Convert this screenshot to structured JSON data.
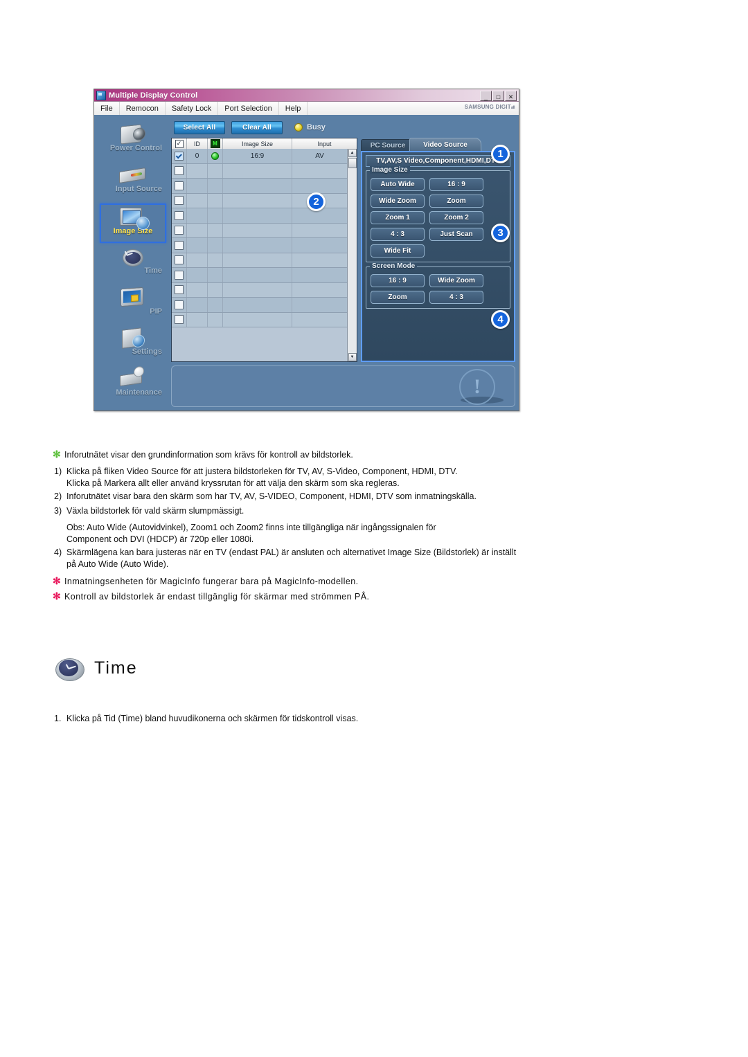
{
  "app": {
    "title": "Multiple Display Control",
    "window_buttons": [
      "_",
      "□",
      "✕"
    ],
    "menu": [
      "File",
      "Remocon",
      "Safety Lock",
      "Port Selection",
      "Help"
    ],
    "brand": "SAMSUNG DIGIT",
    "brand_tail": "all",
    "sidebar": [
      {
        "label": "Power Control",
        "icon": "camera-icon",
        "selected": false
      },
      {
        "label": "Input Source",
        "icon": "input-device-icon",
        "selected": false
      },
      {
        "label": "Image Size",
        "icon": "monitor-image-size-icon",
        "selected": true
      },
      {
        "label": "Time",
        "icon": "clock-icon",
        "selected": false
      },
      {
        "label": "PIP",
        "icon": "pip-monitor-icon",
        "selected": false
      },
      {
        "label": "Settings",
        "icon": "settings-cube-icon",
        "selected": false
      },
      {
        "label": "Maintenance",
        "icon": "maintenance-tool-icon",
        "selected": false
      }
    ],
    "toolbar": {
      "select_all": "Select All",
      "clear_all": "Clear All",
      "status_label": "Busy",
      "status_color": "#e8d52e"
    },
    "table": {
      "columns": [
        "",
        "ID",
        "M",
        "Image Size",
        "Input"
      ],
      "header_check": "✓",
      "rows": [
        {
          "checked": true,
          "id": "0",
          "power": true,
          "image_size": "16:9",
          "input": "AV"
        },
        {
          "checked": false,
          "id": "",
          "power": false,
          "image_size": "",
          "input": ""
        },
        {
          "checked": false,
          "id": "",
          "power": false,
          "image_size": "",
          "input": ""
        },
        {
          "checked": false,
          "id": "",
          "power": false,
          "image_size": "",
          "input": ""
        },
        {
          "checked": false,
          "id": "",
          "power": false,
          "image_size": "",
          "input": ""
        },
        {
          "checked": false,
          "id": "",
          "power": false,
          "image_size": "",
          "input": ""
        },
        {
          "checked": false,
          "id": "",
          "power": false,
          "image_size": "",
          "input": ""
        },
        {
          "checked": false,
          "id": "",
          "power": false,
          "image_size": "",
          "input": ""
        },
        {
          "checked": false,
          "id": "",
          "power": false,
          "image_size": "",
          "input": ""
        },
        {
          "checked": false,
          "id": "",
          "power": false,
          "image_size": "",
          "input": ""
        },
        {
          "checked": false,
          "id": "",
          "power": false,
          "image_size": "",
          "input": ""
        },
        {
          "checked": false,
          "id": "",
          "power": false,
          "image_size": "",
          "input": ""
        }
      ],
      "scroll_up": "▲",
      "scroll_down": "▼"
    },
    "tabs": [
      {
        "label": "PC Source",
        "active": false
      },
      {
        "label": "Video Source",
        "active": true
      }
    ],
    "source_title": "TV,AV,S Video,Component,HDMI,DTV",
    "image_size_group": {
      "legend": "Image Size",
      "buttons": [
        "Auto Wide",
        "16 : 9",
        "Wide Zoom",
        "Zoom",
        "Zoom 1",
        "Zoom 2",
        "4 : 3",
        "Just Scan",
        "Wide Fit"
      ]
    },
    "screen_mode_group": {
      "legend": "Screen Mode",
      "buttons": [
        "16 : 9",
        "Wide Zoom",
        "Zoom",
        "4 : 3"
      ]
    },
    "status_icon": "exclamation-mark-icon",
    "status_icon_glyph": "!",
    "badges": [
      "1",
      "2",
      "3",
      "4"
    ],
    "badge_color": "#1464dc"
  },
  "doc": {
    "notes": [
      {
        "marker": "✻",
        "marker_color": "green",
        "text": "Inforutnätet visar den grundinformation som krävs för kontroll av bildstorlek."
      },
      {
        "marker": "✻",
        "marker_color": "red",
        "text": "Inmatningsenheten för MagicInfo fungerar bara på MagicInfo-modellen."
      },
      {
        "marker": "✻",
        "marker_color": "red",
        "text": "Kontroll av bildstorlek är endast tillgänglig för skärmar med strömmen PÅ."
      }
    ],
    "items": [
      {
        "num": "1)",
        "lines": [
          "Klicka på fliken Video Source för att justera bildstorleken för TV, AV, S-Video, Component, HDMI, DTV.",
          "Klicka på Markera allt eller använd kryssrutan för att välja den skärm som ska regleras."
        ]
      },
      {
        "num": "2)",
        "lines": [
          "Inforutnätet visar bara den skärm som har TV, AV, S-VIDEO, Component, HDMI, DTV som inmatningskälla."
        ]
      },
      {
        "num": "3)",
        "lines": [
          "Växla bildstorlek för vald skärm slumpmässigt."
        ]
      },
      {
        "num": "",
        "lines": [
          "Obs: Auto Wide (Autovidvinkel), Zoom1 och Zoom2 finns inte tillgängliga när ingångssignalen för",
          "Component och DVI (HDCP) är 720p eller 1080i."
        ]
      },
      {
        "num": "4)",
        "lines": [
          "Skärmlägena kan bara justeras när en TV (endast PAL) är ansluten och alternativet Image Size (Bildstorlek) är inställt",
          "på Auto Wide (Auto Wide)."
        ]
      }
    ],
    "section": {
      "icon": "clock-icon",
      "title": "Time",
      "steps": [
        {
          "num": "1.",
          "text": "Klicka på Tid (Time) bland huvudikonerna och skärmen för tidskontroll visas."
        }
      ]
    }
  }
}
